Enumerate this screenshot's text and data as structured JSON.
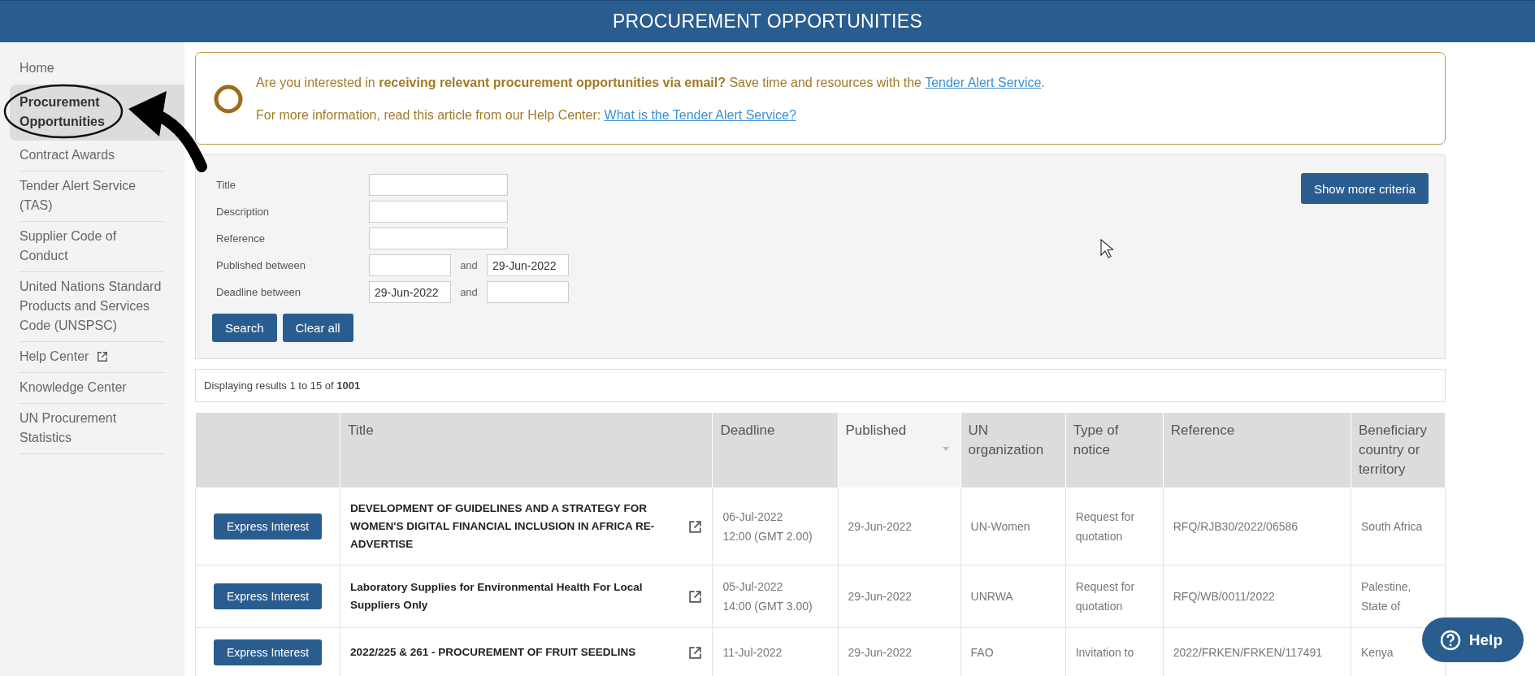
{
  "header": {
    "title": "PROCUREMENT OPPORTUNITIES"
  },
  "sidebar": {
    "items": [
      {
        "label": "Home",
        "selected": false,
        "external": false
      },
      {
        "label": "Procurement Opportunities",
        "selected": true,
        "external": false
      },
      {
        "label": "Contract Awards",
        "selected": false,
        "external": false
      },
      {
        "label": "Tender Alert Service (TAS)",
        "selected": false,
        "external": false
      },
      {
        "label": "Supplier Code of Conduct",
        "selected": false,
        "external": false
      },
      {
        "label": "United Nations Standard Products and Services Code (UNSPSC)",
        "selected": false,
        "external": false
      },
      {
        "label": "Help Center",
        "selected": false,
        "external": true
      },
      {
        "label": "Knowledge Center",
        "selected": false,
        "external": false
      },
      {
        "label": "UN Procurement Statistics",
        "selected": false,
        "external": false
      }
    ]
  },
  "notice": {
    "lines": [
      {
        "text": "Are you interested in **receiving relevant procurement opportunities via email?** Save time and resources with the",
        "link": "Tender Alert Service",
        "after": "."
      },
      {
        "text": "For more information, read this article from our Help Center:",
        "link": "What is the Tender Alert Service?"
      }
    ]
  },
  "search": {
    "fields": [
      {
        "kind": "text",
        "label": "Title"
      },
      {
        "kind": "text",
        "label": "Description"
      },
      {
        "kind": "text",
        "label": "Reference"
      },
      {
        "kind": "range",
        "label": "Published between",
        "joiner": "and",
        "to": "29-Jun-2022"
      },
      {
        "kind": "range",
        "label": "Deadline between",
        "from": "29-Jun-2022",
        "joiner": "and"
      }
    ],
    "buttons": [
      "Search",
      "Clear all"
    ],
    "more_button": "Show more criteria"
  },
  "results": {
    "summary": "Displaying results 1 to 15 of **1001**"
  },
  "table": {
    "columns": [
      {
        "sorted": false
      },
      {
        "label": "Title",
        "sorted": false
      },
      {
        "label": "Deadline",
        "sorted": false
      },
      {
        "label": "Published",
        "sorted": true
      },
      {
        "label": "UN organization",
        "sorted": false
      },
      {
        "label": "Type of notice",
        "sorted": false
      },
      {
        "label": "Reference",
        "sorted": false
      },
      {
        "label": "Beneficiary country or territory",
        "sorted": false
      }
    ],
    "rows": [
      {
        "action": "Express Interest",
        "title": "DEVELOPMENT OF GUIDELINES AND A STRATEGY FOR WOMEN'S DIGITAL FINANCIAL INCLUSION IN AFRICA RE-ADVERTISE",
        "external": true,
        "deadline": [
          "06-Jul-2022",
          "12:00 (GMT 2.00)"
        ],
        "published": "29-Jun-2022",
        "organization": "UN-Women",
        "notice_type": "Request for quotation",
        "reference": "RFQ/RJB30/2022/06586",
        "country": "South Africa"
      },
      {
        "action": "Express Interest",
        "title": "Laboratory Supplies for Environmental Health For Local Suppliers Only",
        "external": true,
        "deadline": [
          "05-Jul-2022",
          "14:00 (GMT 3.00)"
        ],
        "published": "29-Jun-2022",
        "organization": "UNRWA",
        "notice_type": "Request for quotation",
        "reference": "RFQ/WB/0011/2022",
        "country": "Palestine, State of"
      },
      {
        "action": "Express Interest",
        "title": "2022/225 & 261 - PROCUREMENT OF FRUIT SEEDLINS",
        "external": true,
        "deadline": [
          "11-Jul-2022"
        ],
        "published": "29-Jun-2022",
        "organization": "FAO",
        "notice_type": "Invitation to",
        "reference": "2022/FRKEN/FRKEN/117491",
        "country": "Kenya"
      }
    ]
  },
  "help": {
    "label": "Help"
  }
}
